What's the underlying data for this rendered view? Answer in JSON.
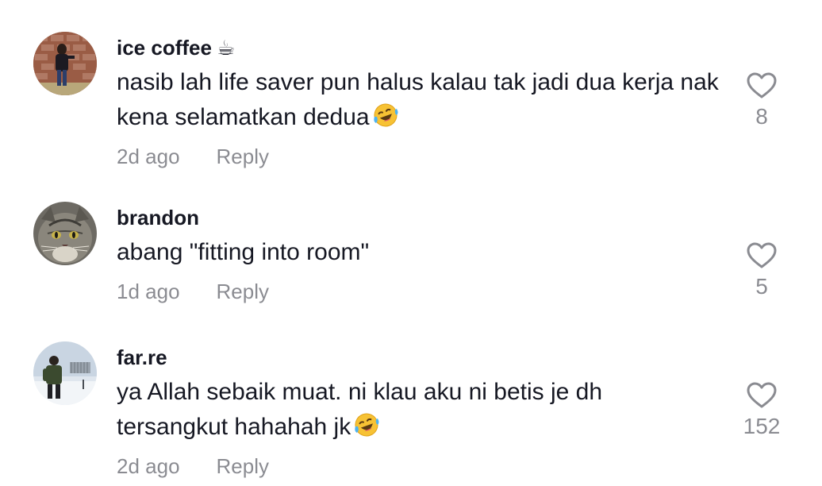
{
  "comments": [
    {
      "username": "ice coffee",
      "username_emoji": "☕",
      "text": "nasib lah life saver pun halus kalau tak jadi dua kerja nak kena selamatkan dedua",
      "emoji": "laughing-emoji",
      "time": "2d ago",
      "reply_label": "Reply",
      "likes": "8",
      "avatar": "avatar-person-brick-wall"
    },
    {
      "username": "brandon",
      "text": "abang \"fitting into room\"",
      "time": "1d ago",
      "reply_label": "Reply",
      "likes": "5",
      "avatar": "avatar-cat"
    },
    {
      "username": "far.re",
      "text": "ya Allah sebaik muat. ni klau aku ni betis je dh tersangkut hahahah jk",
      "emoji": "laughing-emoji",
      "time": "2d ago",
      "reply_label": "Reply",
      "likes": "152",
      "avatar": "avatar-person-snow"
    }
  ],
  "icons": {
    "like": "heart-outline-icon"
  },
  "colors": {
    "text": "#161823",
    "muted": "rgba(22,24,35,0.5)",
    "background": "#ffffff"
  }
}
